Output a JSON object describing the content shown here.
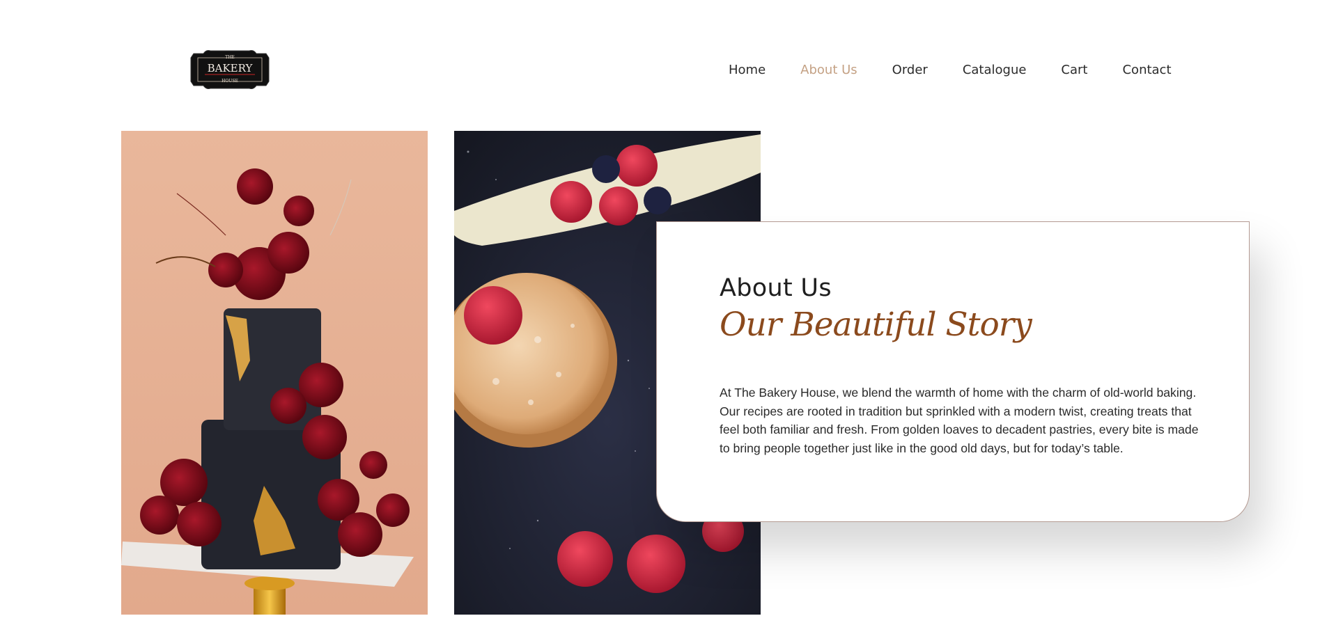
{
  "header": {
    "logo": {
      "icon": "bakery-logo",
      "text_top": "THE",
      "text_main": "BAKERY",
      "text_bottom": "HOUSE"
    },
    "nav": [
      {
        "label": "Home",
        "active": false
      },
      {
        "label": "About Us",
        "active": true
      },
      {
        "label": "Order",
        "active": false
      },
      {
        "label": "Catalogue",
        "active": false
      },
      {
        "label": "Cart",
        "active": false
      },
      {
        "label": "Contact",
        "active": false
      }
    ]
  },
  "gallery": {
    "images": [
      {
        "icon": "cake-photo"
      },
      {
        "icon": "tart-photo"
      }
    ]
  },
  "about": {
    "title": "About Us",
    "subtitle": "Our Beautiful Story",
    "body": "At The Bakery House, we blend the warmth of home with the charm of old-world baking. Our recipes are rooted in tradition but sprinkled with a modern twist, creating treats that feel both familiar and fresh. From golden loaves to decadent pastries, every bite is made to bring people together just like in the good old days, but for today’s table."
  },
  "colors": {
    "accent": "#c4a184",
    "subtitle": "#8b4a1d",
    "card_border": "#b49a92",
    "text": "#2a2a2a",
    "background": "#ffffff"
  }
}
